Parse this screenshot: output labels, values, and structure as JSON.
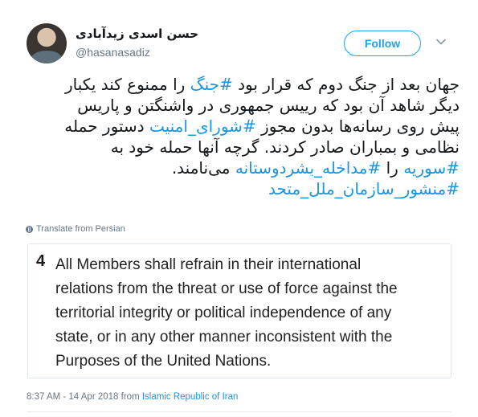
{
  "author": {
    "name": "حسن اسدی زیدآبادی",
    "handle": "@hasanasadiz"
  },
  "follow_button": {
    "label": "Follow"
  },
  "tweet": {
    "lines": [
      [
        {
          "text": "جهان بعد از جنگ دوم که قرار بود ",
          "hashtag": false
        },
        {
          "text": "#جنگ",
          "hashtag": true
        },
        {
          "text": " را ممنوع کند یکبار",
          "hashtag": false
        }
      ],
      [
        {
          "text": "دیگر شاهد آن بود که رییس جمهوری در واشنگتن و پاریس",
          "hashtag": false
        }
      ],
      [
        {
          "text": "پیش روی رسانه‌ها بدون مجوز ",
          "hashtag": false
        },
        {
          "text": "#شورای_امنیت",
          "hashtag": true
        },
        {
          "text": " دستور حمله",
          "hashtag": false
        }
      ],
      [
        {
          "text": "نظامی و بمباران صادر کردند. گرچه آنها حمله خود به",
          "hashtag": false
        }
      ],
      [
        {
          "text": "#سوریه",
          "hashtag": true
        },
        {
          "text": " را ",
          "hashtag": false
        },
        {
          "text": "#مداخله_بشردوستانه",
          "hashtag": true
        },
        {
          "text": " می‌نامند.",
          "hashtag": false
        }
      ],
      [
        {
          "text": "#منشور_سازمان_ملل_متحد",
          "hashtag": true
        }
      ]
    ]
  },
  "translate_link": "Translate from Persian",
  "quote_card": {
    "number": "4",
    "lines": [
      "All Members shall refrain in their international",
      "relations from the threat or use of force against the",
      "territorial integrity or political independence of any",
      "state, or in any other manner inconsistent with the",
      "Purposes of the United Nations."
    ]
  },
  "meta": {
    "timestamp": "8:37 AM - 14 Apr 2018",
    "from_label": "from",
    "location": "Islamic Republic of Iran"
  },
  "colors": {
    "accent": "#1da1f2",
    "hashtag": "#1b95e0",
    "muted": "#657786",
    "border": "#e1e8ed"
  },
  "icons": [
    "avatar-photo",
    "chevron-down-icon",
    "globe-icon"
  ]
}
